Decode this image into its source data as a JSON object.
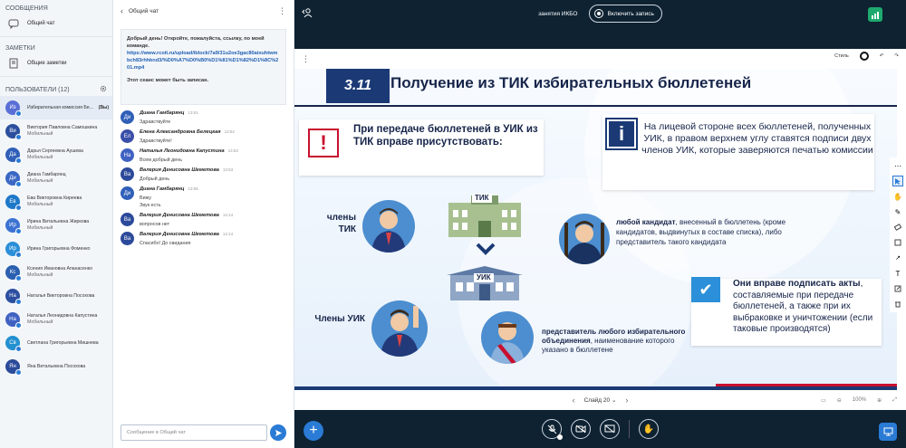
{
  "sidebar": {
    "messages_header": "СООБЩЕНИЯ",
    "public_chat": "Общий чат",
    "notes_header": "ЗАМЕТКИ",
    "shared_notes": "Общие заметки",
    "users_header": "ПОЛЬЗОВАТЕЛИ (12)",
    "users": [
      {
        "initials": "Из",
        "name": "Избирательная комиссия Бе...",
        "sub": "",
        "color": "#5a6fd6",
        "badge": "(Вы)",
        "active": true
      },
      {
        "initials": "Ви",
        "name": "Виктория Павловна Самошкина",
        "sub": "Мобильный",
        "color": "#2b4f9e",
        "active": false
      },
      {
        "initials": "Да",
        "name": "Дарья Сергеевна Аушева",
        "sub": "Мобильный",
        "color": "#2f5fb8",
        "active": false
      },
      {
        "initials": "Ди",
        "name": "Диана Гамбарянц",
        "sub": "Мобильный",
        "color": "#3a67c4",
        "active": false
      },
      {
        "initials": "Ев",
        "name": "Ева Викторовна Киреева",
        "sub": "Мобильный",
        "color": "#1e78c8",
        "active": false
      },
      {
        "initials": "Ир",
        "name": "Ирина Витальевна Жиркова",
        "sub": "Мобильный",
        "color": "#3c72d2",
        "active": false
      },
      {
        "initials": "Ир",
        "name": "Ирина Григорьевна Фоменко",
        "sub": "",
        "color": "#2a8fd8",
        "active": false
      },
      {
        "initials": "Кс",
        "name": "Ксения Ивановна Апанасенко",
        "sub": "Мобильный",
        "color": "#2a5fb0",
        "active": false
      },
      {
        "initials": "На",
        "name": "Наталья Викторовна Посохова",
        "sub": "",
        "color": "#2c4fa0",
        "active": false
      },
      {
        "initials": "На",
        "name": "Наталья Леонидовна Капустина",
        "sub": "Мобильный",
        "color": "#3f62c2",
        "active": false
      },
      {
        "initials": "Св",
        "name": "Светлана Григорьевна Мишнева",
        "sub": "",
        "color": "#2390d0",
        "active": false
      },
      {
        "initials": "Ян",
        "name": "Яна Витальевна Посохова",
        "sub": "",
        "color": "#2c4a9a",
        "active": false
      }
    ]
  },
  "chat": {
    "title": "Общий чат",
    "welcome_line1": "Добрый день! Откройте, пожалуйста, ссылку, по моей команде.",
    "welcome_link": "https://www.rcoit.ru/upload/iblock/7a9/31u2oe3gac80aixuhtwmbch83rhhknd3/%D0%A7%D0%B0%D1%81%D1%82%D1%8C%201.mp4",
    "welcome_line2": "Этот сеанс может быть записан.",
    "messages": [
      {
        "initials": "Ди",
        "color": "#2f5fb8",
        "author": "Диана Гамбарянц",
        "time": "13:51",
        "text": "Здравствуйте"
      },
      {
        "initials": "Ел",
        "color": "#3a4fa8",
        "author": "Елена Александровна Белецкая",
        "time": "13:52",
        "text": "Здравствуйте!"
      },
      {
        "initials": "На",
        "color": "#3f62c2",
        "author": "Наталья Леонидовна Капустина",
        "time": "13:53",
        "text": "Всем добрый день"
      },
      {
        "initials": "Ва",
        "color": "#2c4a9a",
        "author": "Валерия Денисовна Шеметова",
        "time": "13:53",
        "text": "Добрый день"
      },
      {
        "initials": "Ди",
        "color": "#2f5fb8",
        "author": "Диана Гамбарянц",
        "time": "13:55",
        "text": "Вижу\nЗвук есть"
      },
      {
        "initials": "Ва",
        "color": "#2c4a9a",
        "author": "Валерия Денисовна Шеметова",
        "time": "14:14",
        "text": "вопросов нет"
      },
      {
        "initials": "Ва",
        "color": "#2c4a9a",
        "author": "Валерия Денисовна Шеметова",
        "time": "14:14",
        "text": "Спасибо! До свидания"
      }
    ],
    "input_placeholder": "Сообщение в Общий чат"
  },
  "main": {
    "meeting_title": "занятия ИКБО",
    "record_label": "Включить запись",
    "tool_label": "Стиль",
    "slide_label": "Слайд 20",
    "zoom": "100%"
  },
  "slide": {
    "number": "3.11",
    "title": "Получение из ТИК избирательных бюллетеней",
    "left_heading": "При передаче бюллетеней в УИК из ТИК вправе присутствовать:",
    "right_info": "На лицевой стороне всех бюллетеней, полученных УИК, в правом верхнем углу ставятся подписи двух членов УИК, которые заверяются печатью комиссии",
    "tik_members": "члены ТИК",
    "tik_label": "ТИК",
    "uik_label": "УИК",
    "uik_members": "Члены УИК",
    "candidate_bold": "любой кандидат",
    "candidate_text": ", внесенный в бюллетень (кроме кандидатов, выдвинутых в составе списка), либо представитель такого кандидата",
    "rep_bold": "представитель любого избирательного объединения",
    "rep_text": ", наименование которого указано в бюллетене",
    "sign_bold": "Они вправе подписать акты",
    "sign_text": ", составляемые при передаче бюллетеней, а также при их выбраковке и уничтожении (если таковые производятся)"
  },
  "colors": {
    "accent": "#2a7bd5",
    "dark_bg": "#0e2232",
    "slide_navy": "#1b3a75",
    "slide_red": "#c8102e"
  }
}
